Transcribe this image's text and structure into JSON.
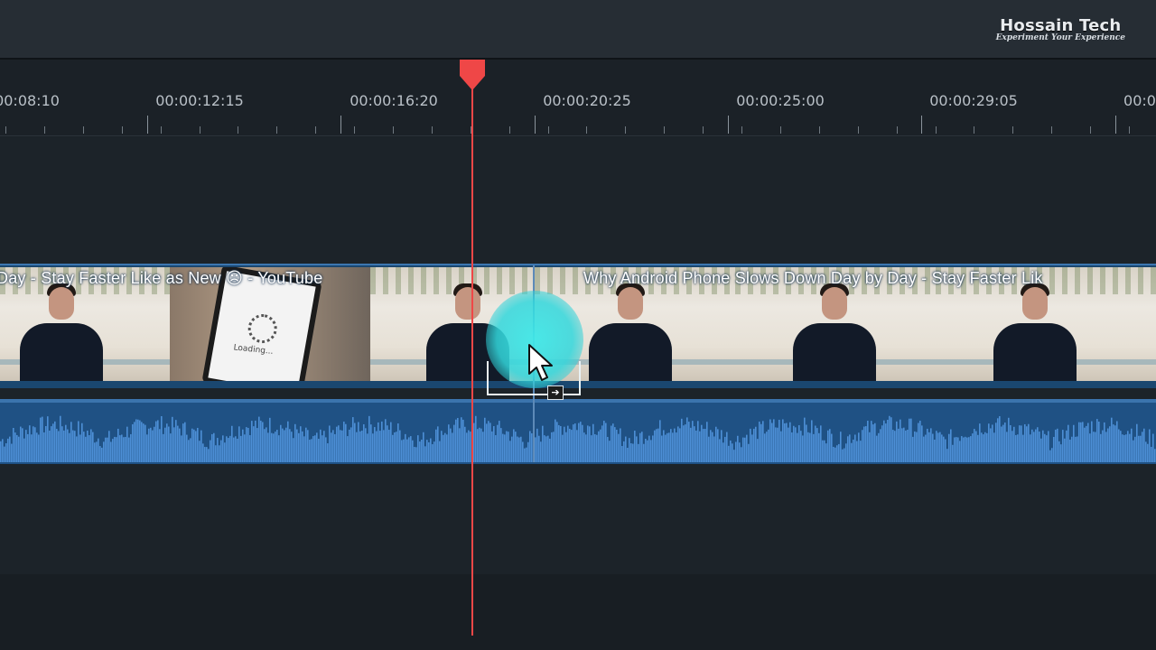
{
  "watermark": {
    "title": "Hossain Tech",
    "subtitle": "Experiment Your Experience"
  },
  "timeline": {
    "timecodes": [
      "00:08:10",
      "00:00:12:15",
      "00:00:16:20",
      "00:00:20:25",
      "00:00:25:00",
      "00:00:29:05",
      "00:0"
    ],
    "playhead_time_between": [
      "00:00:16:20",
      "00:00:20:25"
    ],
    "colors": {
      "background": "#1c2329",
      "video_track": "#1a4770",
      "audio_track": "#1f5184",
      "waveform": "#4d8fd6",
      "playhead": "#ef4747",
      "cursor_highlight": "#40e8e8"
    }
  },
  "clips": {
    "left_title": "Day - Stay Faster Like as New ☹ - YouTube",
    "right_title": "Why Android Phone Slows Down Day by Day - Stay Faster Lik"
  },
  "thumbnail_overlay": {
    "loading_text": "Loading..."
  },
  "icons": {
    "playhead": "playhead-marker-icon",
    "cursor": "mouse-pointer-icon",
    "trim": "trim-arrow-icon"
  }
}
